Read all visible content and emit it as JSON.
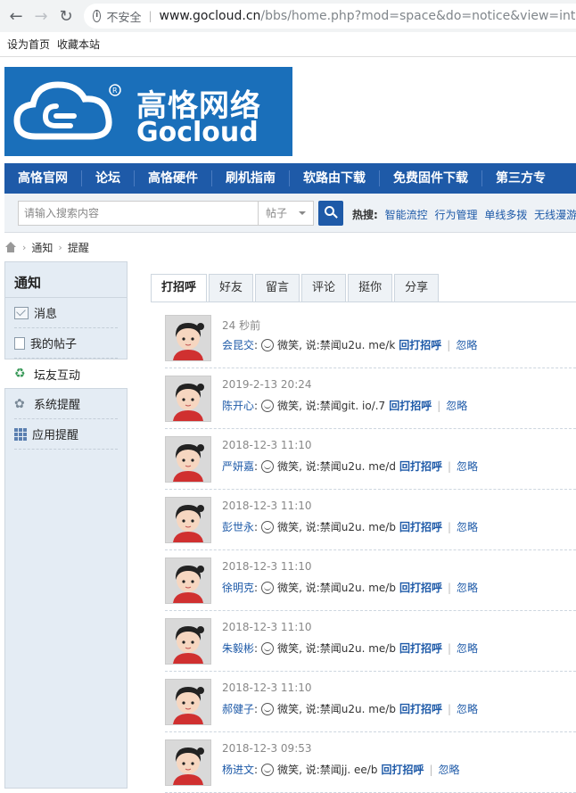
{
  "browser": {
    "security_label": "不安全",
    "url_host": "www.gocloud.cn",
    "url_rest": "/bbs/home.php?mod=space&do=notice&view=inte"
  },
  "bookmarks": [
    "设为首页",
    "收藏本站"
  ],
  "logo": {
    "cn": "高恪网络",
    "en": "Gocloud"
  },
  "mainnav": [
    "高恪官网",
    "论坛",
    "高恪硬件",
    "刷机指南",
    "软路由下载",
    "免费固件下载",
    "第三方专"
  ],
  "search": {
    "placeholder": "请输入搜索内容",
    "scope": "帖子",
    "hot_label": "热搜:",
    "hot_terms": [
      "智能流控",
      "行为管理",
      "单线多拨",
      "无线漫游"
    ]
  },
  "breadcrumb": [
    "通知",
    "提醒"
  ],
  "sidebar": {
    "title": "通知",
    "items": [
      {
        "label": "消息",
        "icon": "mail-icon"
      },
      {
        "label": "我的帖子",
        "icon": "document-icon"
      },
      {
        "label": "坛友互动",
        "icon": "recycle-icon",
        "active": true
      },
      {
        "label": "系统提醒",
        "icon": "gear-icon"
      },
      {
        "label": "应用提醒",
        "icon": "grid-icon"
      }
    ]
  },
  "tabs": [
    "打招呼",
    "好友",
    "留言",
    "评论",
    "挺你",
    "分享"
  ],
  "notices": [
    {
      "time": "24 秒前",
      "name": "会昆交",
      "msg": "微笑, 说:禁闻u2u. me/k"
    },
    {
      "time": "2019-2-13 20:24",
      "name": "陈开心",
      "msg": "微笑, 说:禁闻git. io/.7"
    },
    {
      "time": "2018-12-3 11:10",
      "name": "严妍嘉",
      "msg": "微笑, 说:禁闻u2u. me/d"
    },
    {
      "time": "2018-12-3 11:10",
      "name": "彭世永",
      "msg": "微笑, 说:禁闻u2u. me/b"
    },
    {
      "time": "2018-12-3 11:10",
      "name": "徐明克",
      "msg": "微笑, 说:禁闻u2u. me/b"
    },
    {
      "time": "2018-12-3 11:10",
      "name": "朱毅彬",
      "msg": "微笑, 说:禁闻u2u. me/b"
    },
    {
      "time": "2018-12-3 11:10",
      "name": "郝健子",
      "msg": "微笑, 说:禁闻u2u. me/b"
    },
    {
      "time": "2018-12-3 09:53",
      "name": "杨进文",
      "msg": "微笑, 说:禁闻jj. ee/b"
    }
  ],
  "notice_actions": {
    "reply": "回打招呼",
    "separator": "|",
    "ignore": "忽略"
  },
  "colors": {
    "brand": "#1e5aa8",
    "logo_bg": "#1a6fba"
  }
}
